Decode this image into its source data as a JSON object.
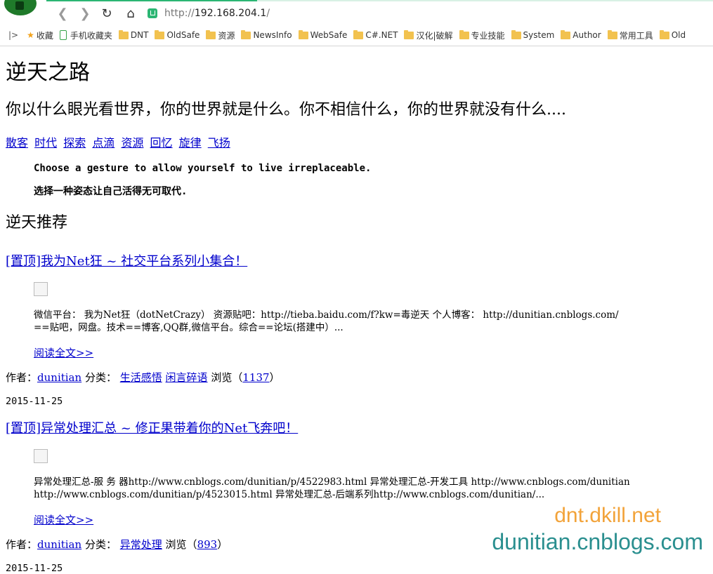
{
  "browser": {
    "url_scheme": "http://",
    "url_host": "192.168.204.1",
    "url_path": "/",
    "bookmarks": [
      {
        "label": "收藏",
        "type": "star"
      },
      {
        "label": "手机收藏夹",
        "type": "phone"
      },
      {
        "label": "DNT",
        "type": "folder"
      },
      {
        "label": "OldSafe",
        "type": "folder"
      },
      {
        "label": "资源",
        "type": "folder"
      },
      {
        "label": "NewsInfo",
        "type": "folder"
      },
      {
        "label": "WebSafe",
        "type": "folder"
      },
      {
        "label": "C#.NET",
        "type": "folder"
      },
      {
        "label": "汉化|破解",
        "type": "folder"
      },
      {
        "label": "专业技能",
        "type": "folder"
      },
      {
        "label": "System",
        "type": "folder"
      },
      {
        "label": "Author",
        "type": "folder"
      },
      {
        "label": "常用工具",
        "type": "folder"
      },
      {
        "label": "Old",
        "type": "folder"
      }
    ]
  },
  "page": {
    "title": "逆天之路",
    "subtitle": "你以什么眼光看世界，你的世界就是什么。你不相信什么，你的世界就没有什么....",
    "menu": [
      "散客",
      "时代",
      "探索",
      "点滴",
      "资源",
      "回忆",
      "旋律",
      "飞扬"
    ],
    "quote_en": "Choose a gesture to allow yourself to live irreplaceable.",
    "quote_zh": "选择一种姿态让自己活得无可取代.",
    "section_title": "逆天推荐",
    "posts": [
      {
        "title": "[置顶]我为Net狂 ~ 社交平台系列小集合！",
        "excerpt_line1": "微信平台： 我为Net狂（dotNetCrazy） 资源贴吧：http://tieba.baidu.com/f?kw=毒逆天 个人博客： http://dunitian.cnblogs.com/",
        "excerpt_line2": "==贴吧，网盘。技术==博客,QQ群,微信平台。综合==论坛(搭建中）...",
        "read_more": "阅读全文>>",
        "author_label": "作者：",
        "author": "dunitian",
        "category_label": "分类：",
        "categories": [
          "生活感悟",
          "闲言碎语"
        ],
        "views_label": "浏览（",
        "views": "1137",
        "views_close": "）",
        "date": "2015-11-25"
      },
      {
        "title": "[置顶]异常处理汇总 ~ 修正果带着你的Net飞奔吧！",
        "excerpt_line1": "异常处理汇总-服 务 器http://www.cnblogs.com/dunitian/p/4522983.html 异常处理汇总-开发工具 http://www.cnblogs.com/dunitian",
        "excerpt_line2": "http://www.cnblogs.com/dunitian/p/4523015.html 异常处理汇总-后端系列http://www.cnblogs.com/dunitian/...",
        "read_more": "阅读全文>>",
        "author_label": "作者：",
        "author": "dunitian",
        "category_label": "分类：",
        "categories": [
          "异常处理"
        ],
        "views_label": "浏览（",
        "views": "893",
        "views_close": "）",
        "date": "2015-11-25"
      }
    ]
  },
  "watermark": {
    "line1": "dnt.dkill.net",
    "line2": "dunitian.cnblogs.com"
  },
  "colors": {
    "link": "#0000cc",
    "accent": "#2bb673",
    "watermark1": "#f2a33a",
    "watermark2": "#2a8f8f"
  }
}
